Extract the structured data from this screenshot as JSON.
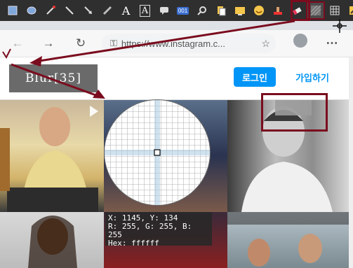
{
  "toolbar": {
    "icons": [
      "select-icon",
      "shape-icon",
      "pencil-icon",
      "line-icon",
      "arrow-icon",
      "marker-icon",
      "text-icon",
      "framed-text-icon",
      "speech-bubble-icon",
      "counter-icon",
      "zoom-icon",
      "copy-icon",
      "image-icon",
      "emoji-icon",
      "stamp-icon",
      "eraser-icon",
      "pixelate-icon",
      "grid-icon",
      "color-picker-icon"
    ],
    "counter_label": "001",
    "text_label": "A",
    "active_tool": "pixelate-icon"
  },
  "browser": {
    "url": "https://www.instagram.c..."
  },
  "instagram": {
    "logo_text": "Blur[35]",
    "login_label": "로그인",
    "signup_label": "가입하기"
  },
  "picker": {
    "line1": "X: 1145, Y: 134",
    "line2": "R: 255, G: 255, B: 255",
    "line3": "Hex: ffffff"
  },
  "colors": {
    "annotation": "#7a0c1e",
    "button_blue": "#0095f6"
  }
}
